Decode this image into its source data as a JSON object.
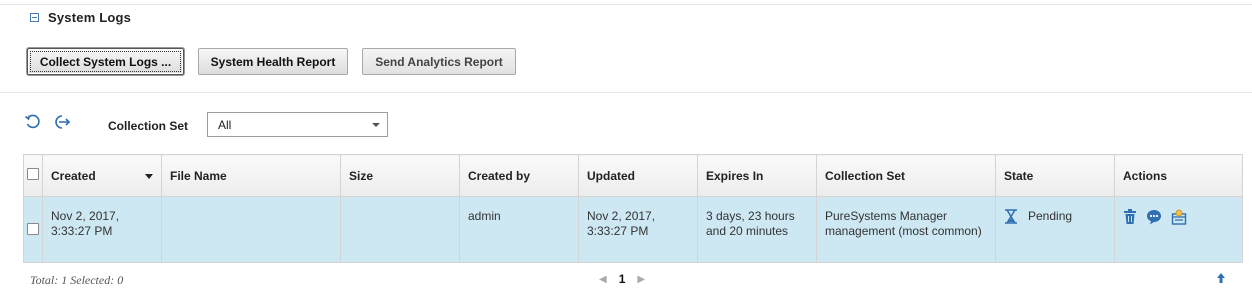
{
  "section": {
    "title": "System Logs"
  },
  "toolbar": {
    "collect_label": "Collect System Logs ...",
    "health_label": "System Health Report",
    "analytics_label": "Send Analytics Report"
  },
  "filter": {
    "label": "Collection Set",
    "selected": "All"
  },
  "table": {
    "headers": [
      "Created",
      "File Name",
      "Size",
      "Created by",
      "Updated",
      "Expires In",
      "Collection Set",
      "State",
      "Actions"
    ],
    "rows": [
      {
        "created": "Nov 2, 2017, 3:33:27 PM",
        "file_name": "",
        "size": "",
        "created_by": "admin",
        "updated": "Nov 2, 2017, 3:33:27 PM",
        "expires_in": "3 days, 23 hours and 20 minutes",
        "collection_set": "PureSystems Manager management (most common)",
        "state": "Pending"
      }
    ]
  },
  "footer": {
    "summary": "Total: 1 Selected: 0",
    "page": "1"
  },
  "icons": {
    "refresh": "refresh-icon",
    "export": "export-icon",
    "state": "hourglass-icon",
    "actions": [
      "trash-icon",
      "comment-icon",
      "scheduled-task-icon"
    ]
  },
  "colors": {
    "row_selected_bg": "#cde8f2",
    "icon_blue": "#2f6fb3"
  }
}
